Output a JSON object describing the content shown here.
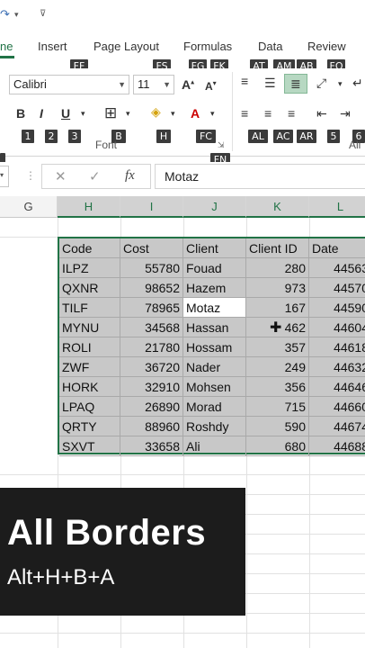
{
  "qat": {
    "redo_icon": "redo-icon",
    "menu_icon": "chevron-down-icon",
    "customize_icon": "qat-customize-icon"
  },
  "tabs": [
    {
      "label": "ne",
      "active": true
    },
    {
      "label": "Insert"
    },
    {
      "label": "Page Layout"
    },
    {
      "label": "Formulas"
    },
    {
      "label": "Data"
    },
    {
      "label": "Review"
    }
  ],
  "keytips_row1": [
    "FF",
    "FS",
    "FG",
    "FK",
    "AT",
    "AM",
    "AB",
    "FQ"
  ],
  "keytips_row2": [
    "1",
    "2",
    "3",
    "B",
    "H",
    "FC",
    "AL",
    "AC",
    "AR",
    "5",
    "6"
  ],
  "keytip_fn": "FN",
  "font": {
    "name": "Calibri",
    "size": "11",
    "group_label": "Font",
    "ali_label": "Ali"
  },
  "format_buttons": {
    "bold": "B",
    "italic": "I",
    "underline": "U"
  },
  "formula_bar": {
    "content": "Motaz",
    "fx": "fx"
  },
  "columns": [
    "G",
    "H",
    "I",
    "J",
    "K",
    "L"
  ],
  "table": {
    "headers": [
      "Code",
      "Cost",
      "Client",
      "Client ID",
      "Date"
    ],
    "rows": [
      [
        "ILPZ",
        "55780",
        "Fouad",
        "280",
        "44563"
      ],
      [
        "QXNR",
        "98652",
        "Hazem",
        "973",
        "44570"
      ],
      [
        "TILF",
        "78965",
        "Motaz",
        "167",
        "44590"
      ],
      [
        "MYNU",
        "34568",
        "Hassan",
        "462",
        "44604"
      ],
      [
        "ROLI",
        "21780",
        "Hossam",
        "357",
        "44618"
      ],
      [
        "ZWF",
        "36720",
        "Nader",
        "249",
        "44632"
      ],
      [
        "HORK",
        "32910",
        "Mohsen",
        "356",
        "44646"
      ],
      [
        "LPAQ",
        "26890",
        "Morad",
        "715",
        "44660"
      ],
      [
        "QRTY",
        "88960",
        "Roshdy",
        "590",
        "44674"
      ],
      [
        "SXVT",
        "33658",
        "Ali",
        "680",
        "44688"
      ]
    ]
  },
  "overlay": {
    "title": "All Borders",
    "shortcut": "Alt+H+B+A"
  }
}
